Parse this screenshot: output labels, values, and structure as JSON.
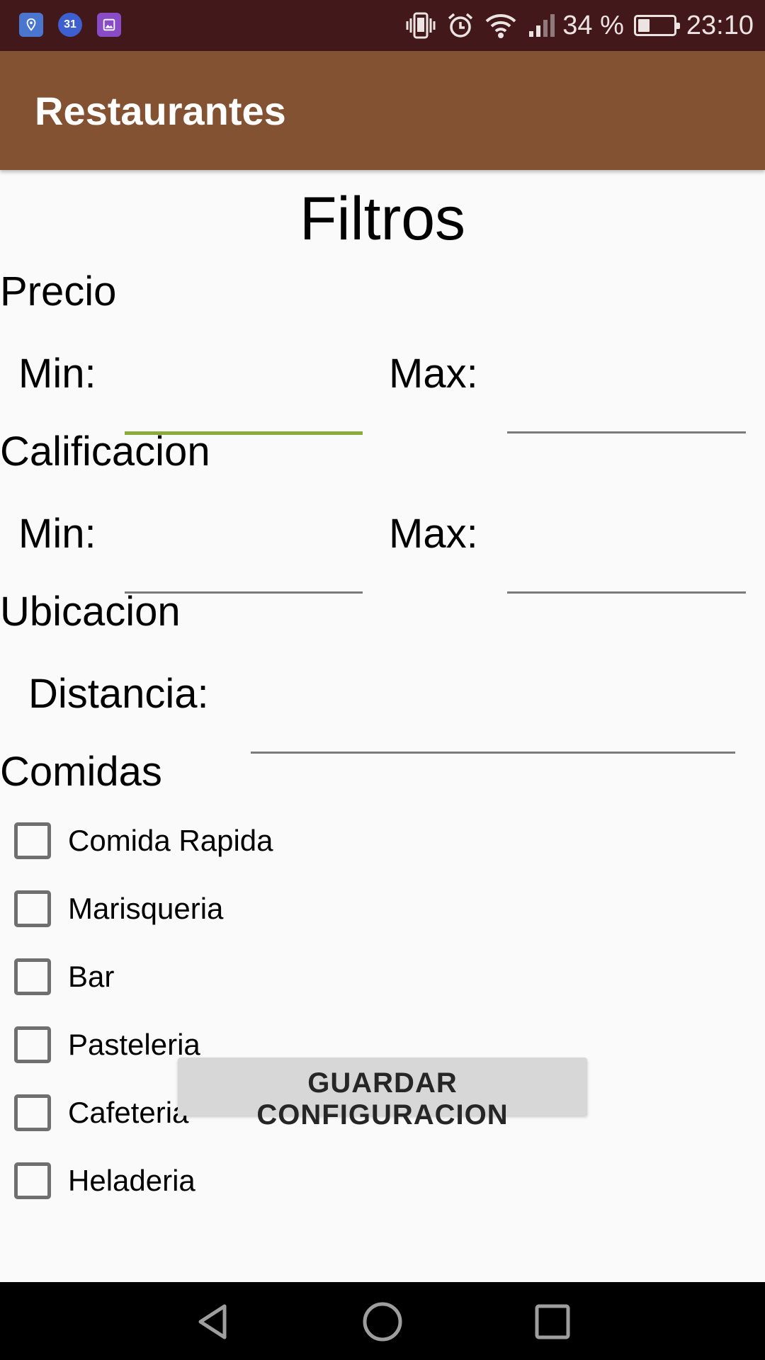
{
  "status_bar": {
    "notification_icons": [
      "location-pin-icon",
      "calendar-icon",
      "gallery-icon"
    ],
    "calendar_day": "31",
    "system_icons": [
      "vibrate-icon",
      "alarm-icon",
      "wifi-icon",
      "signal-icon",
      "battery-icon"
    ],
    "battery_percent": "34 %",
    "battery_level": 0.34,
    "time": "23:10",
    "background_color": "#42181a"
  },
  "app_bar": {
    "title": "Restaurantes",
    "background_color": "#825232"
  },
  "filters": {
    "heading": "Filtros",
    "price": {
      "label": "Precio",
      "min_label": "Min:",
      "min_value": "",
      "max_label": "Max:",
      "max_value": ""
    },
    "rating": {
      "label": "Calificacion",
      "min_label": "Min:",
      "min_value": "",
      "max_label": "Max:",
      "max_value": ""
    },
    "location": {
      "label": "Ubicacion",
      "distance_label": "Distancia:",
      "distance_value": ""
    },
    "foods": {
      "label": "Comidas",
      "options": [
        {
          "label": "Comida Rapida",
          "checked": false
        },
        {
          "label": "Marisqueria",
          "checked": false
        },
        {
          "label": "Bar",
          "checked": false
        },
        {
          "label": "Pasteleria",
          "checked": false
        },
        {
          "label": "Cafeteria",
          "checked": false
        },
        {
          "label": "Heladeria",
          "checked": false
        }
      ]
    },
    "save_button_label": "GUARDAR CONFIGURACION",
    "focus_color": "#8aab3b"
  },
  "nav_bar": {
    "buttons": [
      "back-icon",
      "home-icon",
      "recents-icon"
    ]
  }
}
